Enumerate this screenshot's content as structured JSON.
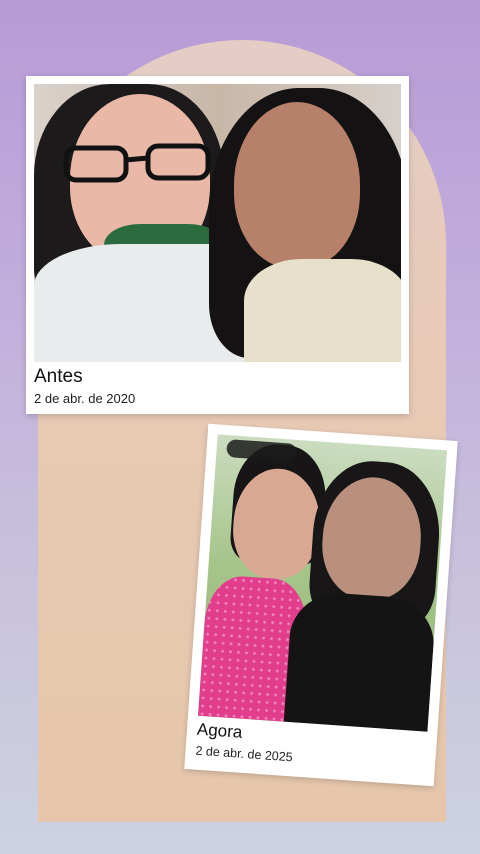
{
  "cards": [
    {
      "title": "Antes",
      "date": "2 de abr. de 2020"
    },
    {
      "title": "Agora",
      "date": "2 de abr. de 2025"
    }
  ],
  "icons": {
    "photo_before": "photo-before-icon",
    "photo_after": "photo-after-icon"
  },
  "colors": {
    "background_top": "#b79ad6",
    "background_bottom": "#cdd2e2",
    "arch": "#e9cbb4",
    "card": "#ffffff"
  }
}
